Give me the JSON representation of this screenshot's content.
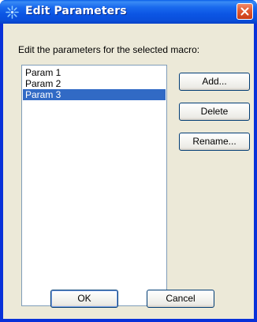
{
  "window": {
    "title": "Edit Parameters",
    "icon": "burst-icon",
    "close_icon": "close-icon"
  },
  "dialog": {
    "instruction": "Edit the parameters for the selected macro:",
    "params": [
      {
        "label": "Param 1",
        "selected": false
      },
      {
        "label": "Param 2",
        "selected": false
      },
      {
        "label": "Param 3",
        "selected": true
      }
    ],
    "buttons": {
      "add": "Add...",
      "delete": "Delete",
      "rename": "Rename...",
      "ok": "OK",
      "cancel": "Cancel"
    }
  },
  "colors": {
    "titlebar": "#0b55e4",
    "selection": "#316ac5",
    "dialog_bg": "#ece9d8",
    "close_button": "#e05a32"
  }
}
